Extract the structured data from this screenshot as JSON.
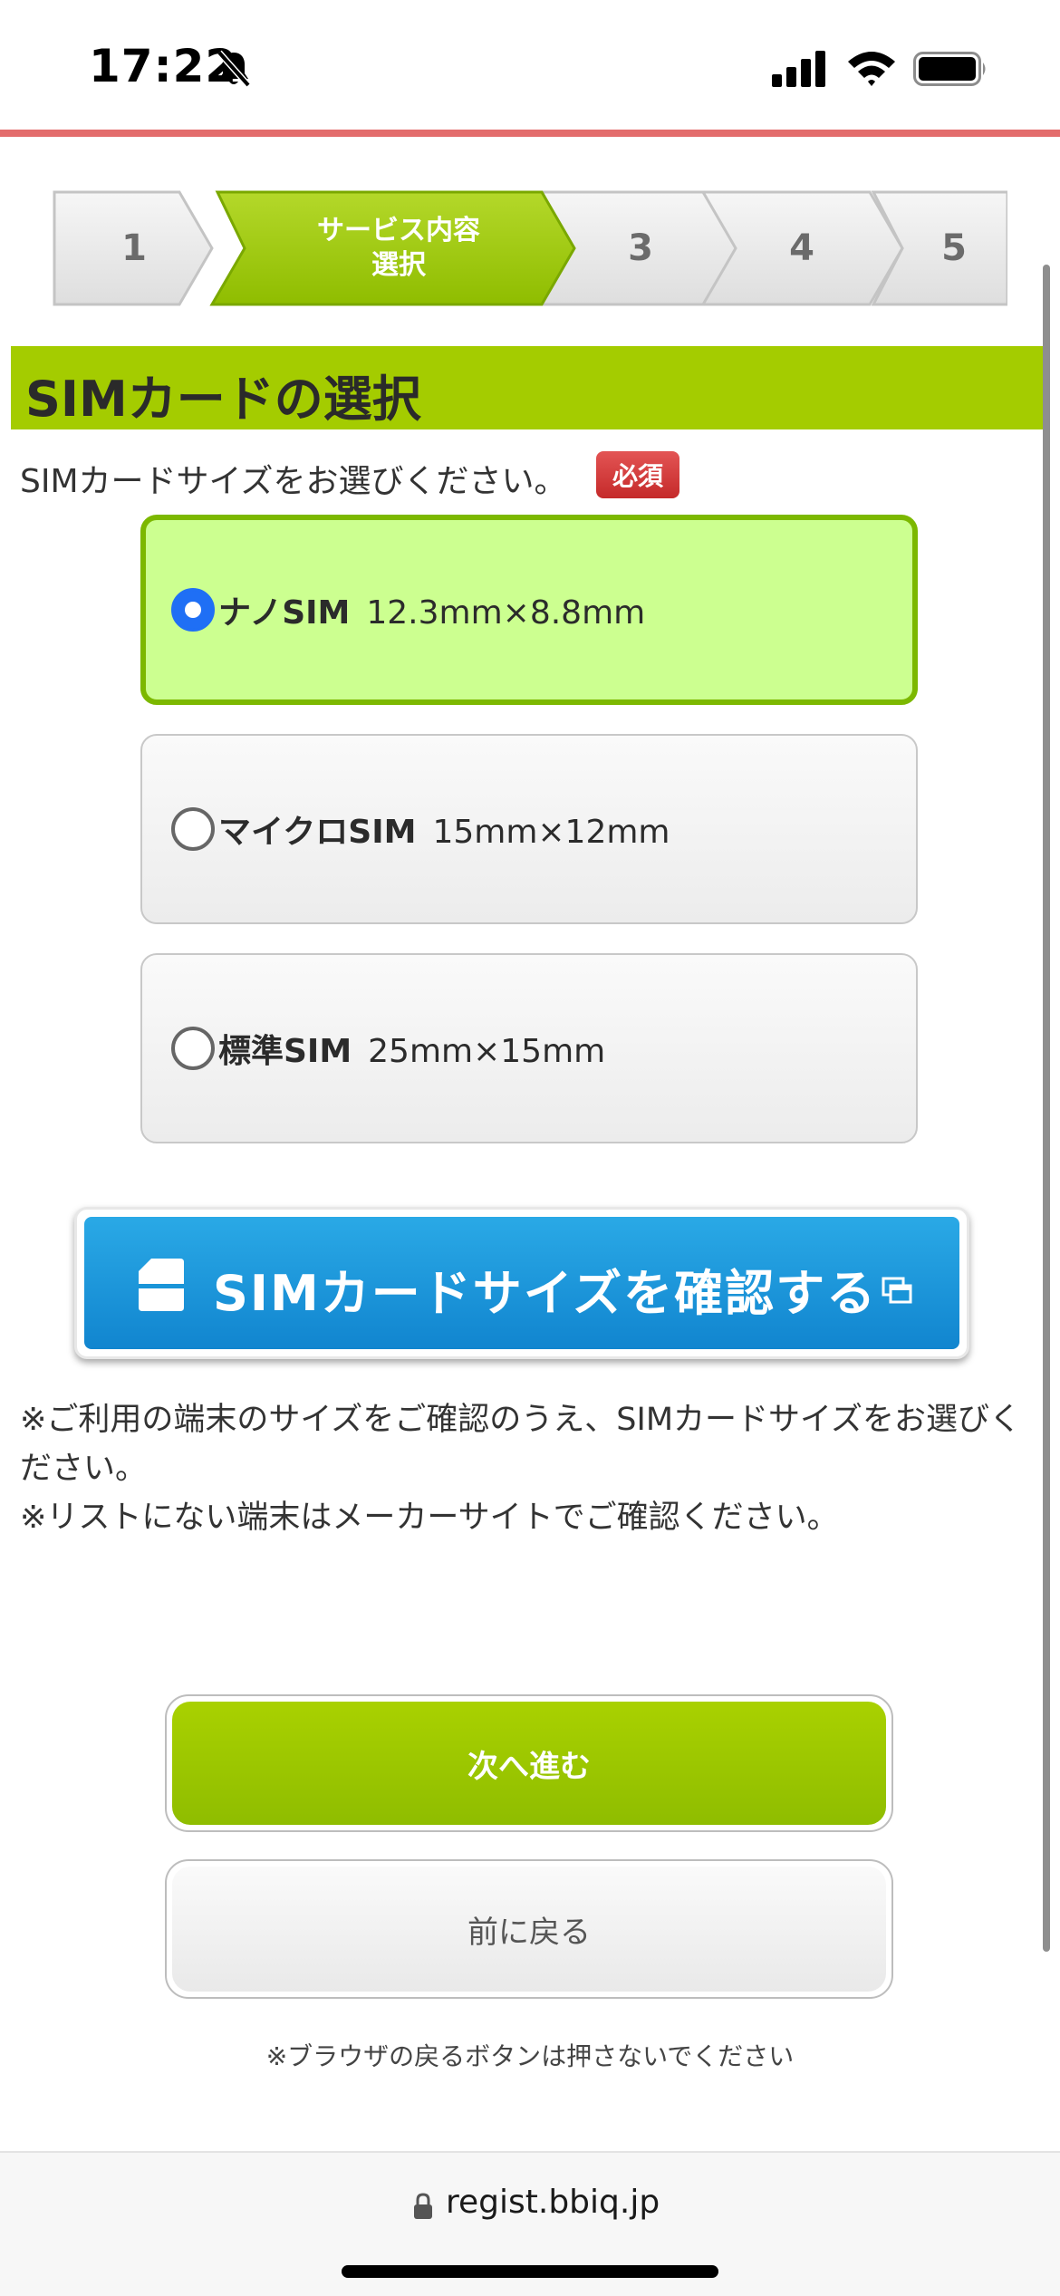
{
  "status_bar": {
    "time": "17:22",
    "icons": [
      "bell-slash-icon",
      "signal-icon",
      "wifi-icon",
      "battery-icon"
    ]
  },
  "steps": [
    {
      "label": "1",
      "current": false
    },
    {
      "label": "サービス内容\n選択",
      "line1": "サービス内容",
      "line2": "選択",
      "current": true
    },
    {
      "label": "3",
      "current": false
    },
    {
      "label": "4",
      "current": false
    },
    {
      "label": "5",
      "current": false
    }
  ],
  "section": {
    "title": "SIMカードの選択",
    "instruction": "SIMカードサイズをお選びください。",
    "required_badge": "必須"
  },
  "sim_options": [
    {
      "name": "ナノSIM",
      "size": "12.3mm×8.8mm",
      "selected": true
    },
    {
      "name": "マイクロSIM",
      "size": "15mm×12mm",
      "selected": false
    },
    {
      "name": "標準SIM",
      "size": "25mm×15mm",
      "selected": false
    }
  ],
  "confirm_button": {
    "label": "SIMカードサイズを確認する"
  },
  "notes": [
    "※ご利用の端末のサイズをご確認のうえ、SIMカードサイズをお選びください。",
    "※リストにない端末はメーカーサイトでご確認ください。"
  ],
  "buttons": {
    "next": "次へ進む",
    "back": "前に戻る"
  },
  "warning": "※ブラウザの戻るボタンは押さないでください",
  "browser": {
    "url": "regist.bbiq.jp"
  },
  "colors": {
    "accent_green": "#a4cc00",
    "selected_bg": "#ccff90",
    "confirm_blue": "#1a98dc",
    "required_red": "#cc3333",
    "top_line": "#e36c6c"
  }
}
